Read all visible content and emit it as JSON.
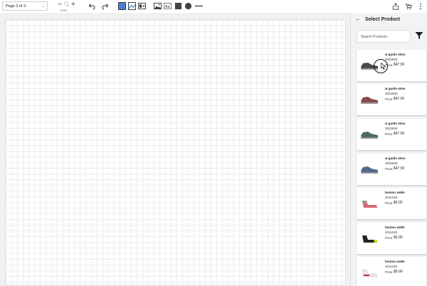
{
  "toolbar": {
    "page_select": "Page 3 of 3",
    "zoom_level": "100%",
    "tooltip": "Undo",
    "tools": [
      {
        "name": "undo-icon"
      },
      {
        "name": "redo-icon"
      },
      {
        "name": "layout-full-icon"
      },
      {
        "name": "layout-image-left-icon"
      },
      {
        "name": "layout-image-text-icon"
      },
      {
        "name": "image-icon"
      },
      {
        "name": "text-icon"
      },
      {
        "name": "square-icon"
      },
      {
        "name": "circle-icon"
      },
      {
        "name": "line-icon"
      }
    ]
  },
  "header_icons": [
    "share-icon",
    "cart-icon",
    "more-icon"
  ],
  "sidebar": {
    "title": "Select Product",
    "search_placeholder": "Search Products",
    "products": [
      {
        "name": "w guide shoe",
        "sku": "3022603",
        "price_label": "Price:",
        "price": "$47.50",
        "color": "#4a4a4a"
      },
      {
        "name": "w guide shoe",
        "sku": "3022603",
        "price_label": "Price:",
        "price": "$47.50",
        "color": "#8a4a4a"
      },
      {
        "name": "w guide shoe",
        "sku": "3022603",
        "price_label": "Price:",
        "price": "$47.50",
        "color": "#4a6a6a"
      },
      {
        "name": "w guide shoe",
        "sku": "3022603",
        "price_label": "Price:",
        "price": "$47.50",
        "color": "#4a6a8a"
      },
      {
        "name": "boston ankle",
        "sku": "4011246",
        "price_label": "Price:",
        "price": "$5.00",
        "color": "#d46a78"
      },
      {
        "name": "boston ankle",
        "sku": "4011246",
        "price_label": "Price:",
        "price": "$5.00",
        "color": "#222222"
      },
      {
        "name": "boston ankle",
        "sku": "4011246",
        "price_label": "Price:",
        "price": "$5.00",
        "color": "#e0e0e0"
      }
    ]
  }
}
